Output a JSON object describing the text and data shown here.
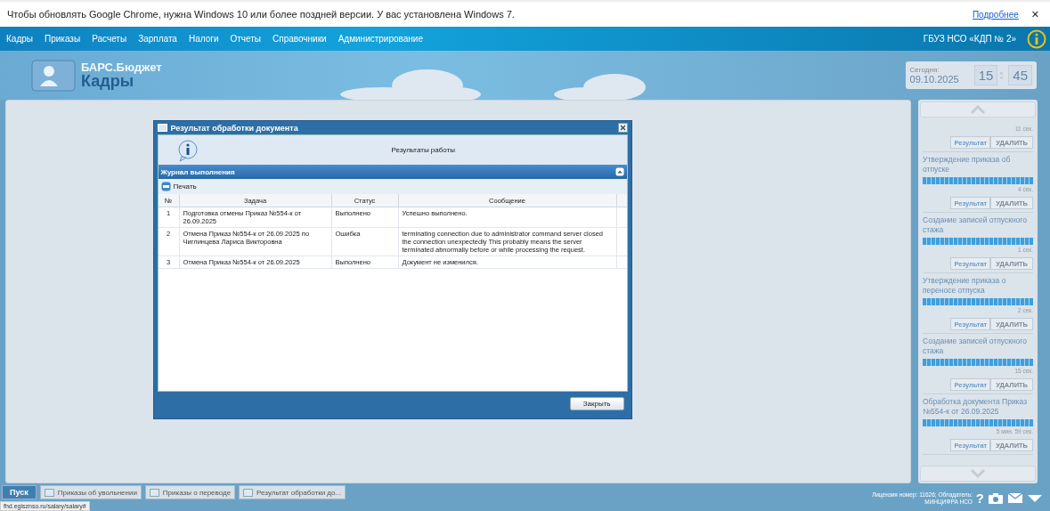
{
  "infobar": {
    "message": "Чтобы обновлять Google Chrome, нужна Windows 10 или более поздней версии. У вас установлена Windows 7.",
    "link": "Подробнее",
    "close": "✕"
  },
  "menu": {
    "items": [
      "Кадры",
      "Приказы",
      "Расчеты",
      "Зарплата",
      "Налоги",
      "Отчеты",
      "Справочники",
      "Администрирование"
    ],
    "organization": "ГБУЗ НСО «КДП № 2»"
  },
  "logo": {
    "line1": "БАРС.Бюджет",
    "line2": "Кадры"
  },
  "today": {
    "label": "Сегодня:",
    "date": "09.10.2025",
    "hours": "15",
    "minutes": "45"
  },
  "dialog": {
    "title": "Результат обработки документа",
    "message": "Результаты работы",
    "panel_title": "Журнал выполнения",
    "print": "Печать",
    "columns": [
      "№",
      "Задача",
      "Статус",
      "Сообщение"
    ],
    "rows": [
      {
        "n": "1",
        "task": "Подготовка отмены Приказ №554-к от 26.09.2025",
        "status": "Выполнено",
        "message": "Успешно выполнено."
      },
      {
        "n": "2",
        "task": "Отмена Приказ №554-к от 26.09.2025 по Чиглинцева Лариса Викторовна",
        "status": "Ошибка",
        "message": "terminating connection due to administrator command server closed the connection unexpectedly This probably means the server terminated abnormally before or while processing the request."
      },
      {
        "n": "3",
        "task": "Отмена Приказ №554-к от 26.09.2025",
        "status": "Выполнено",
        "message": "Документ не изменился."
      }
    ],
    "close_button": "Закрыть"
  },
  "tasks": [
    {
      "time": "11 сек.",
      "result": "Результат",
      "delete": "УДАЛИТЬ"
    },
    {
      "title": "Утверждение приказа об отпуске",
      "level": 1,
      "time": "4 сек.",
      "result": "Результат",
      "delete": "УДАЛИТЬ"
    },
    {
      "title": "Создание записей отпускного стажа",
      "level": 1,
      "time": "1 сек.",
      "result": "Результат",
      "delete": "УДАЛИТЬ"
    },
    {
      "title": "Утверждение приказа о переносе отпуска",
      "level": 1,
      "time": "2 сек.",
      "result": "Результат",
      "delete": "УДАЛИТЬ"
    },
    {
      "title": "Создание записей отпускного стажа",
      "level": 1,
      "time": "15 сек.",
      "result": "Результат",
      "delete": "УДАЛИТЬ"
    },
    {
      "title": "Обработка документа Приказ №554-к от 26.09.2025",
      "level": 1,
      "time": "5 мин. 59 сек.",
      "result": "Результат",
      "delete": "УДАЛИТЬ"
    }
  ],
  "taskbar": {
    "start": "Пуск",
    "windows": [
      "Приказы об увольнении",
      "Приказы о переводе",
      "Результат обработки до..."
    ],
    "license": "Лицензия номер: 11626; Обладатель: МИНЦИФРА НСО",
    "help": "?"
  },
  "status_url": "fhd.egisznso.ru/salary/salary#"
}
